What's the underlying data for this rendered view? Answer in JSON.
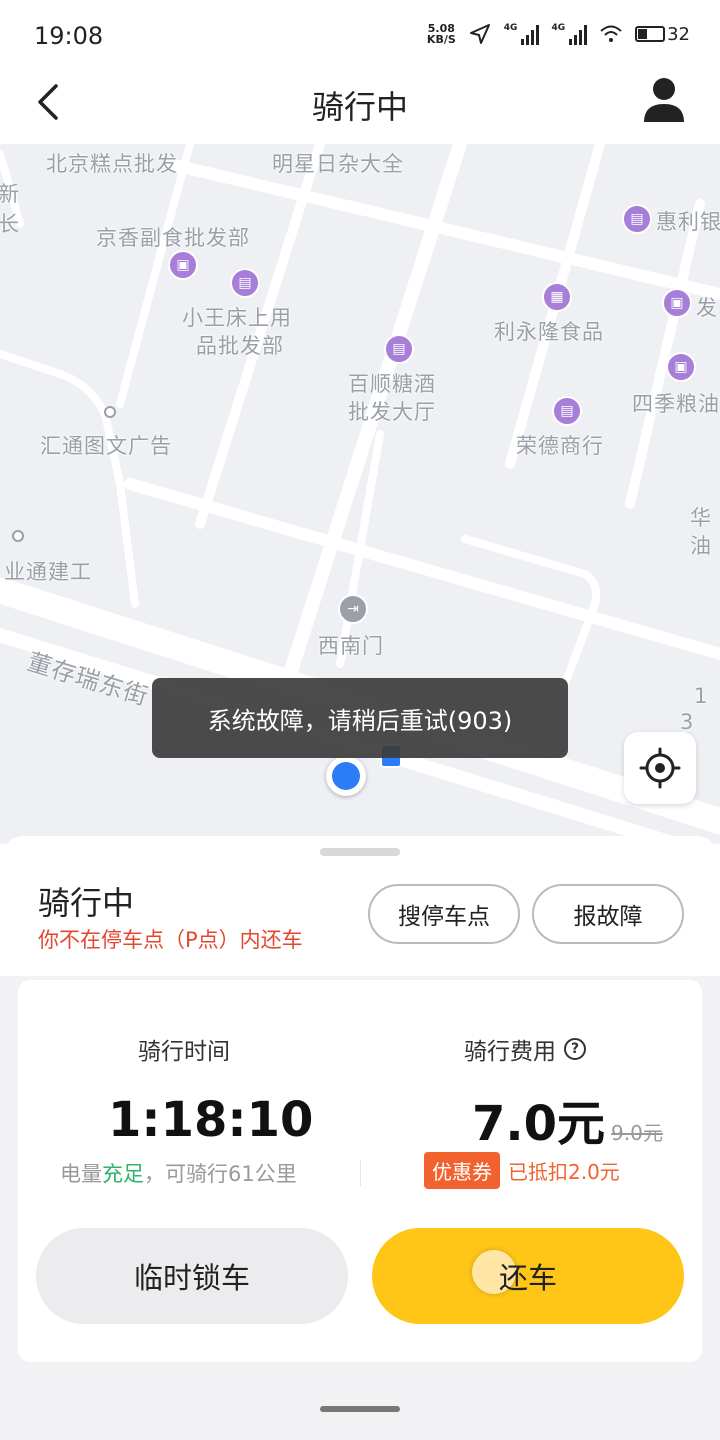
{
  "status_bar": {
    "time": "19:08",
    "net_speed": "5.08\nKB/S",
    "signal_label_1": "4G",
    "signal_label_2": "4G",
    "battery": "32"
  },
  "nav": {
    "title": "骑行中"
  },
  "map": {
    "labels": [
      "北京糕点批发",
      "明星日杂大全",
      "新",
      "长",
      "京香副食批发部",
      "惠利银",
      "小王床上用",
      "品批发部",
      "利永隆食品",
      "发",
      "百顺糖酒",
      "批发大厅",
      "四季粮油",
      "汇通图文广告",
      "荣德商行",
      "业通建工",
      "华",
      "油",
      "西南门",
      "董存瑞东街",
      "1",
      "3"
    ],
    "toast": "系统故障，请稍后重试(903)"
  },
  "sheet": {
    "status": "骑行中",
    "warning": "你不在停车点（P点）内还车",
    "find_parking": "搜停车点",
    "report_fault": "报故障",
    "ride_time_title": "骑行时间",
    "ride_time": "1:18:10",
    "battery_prefix": "电量",
    "battery_state": "充足",
    "battery_suffix": "，可骑行61公里",
    "fee_title": "骑行费用",
    "fee": "7.0元",
    "fee_original": "9.0元",
    "coupon_badge": "优惠券",
    "coupon_text": "已抵扣2.0元",
    "temp_lock": "临时锁车",
    "return_bike": "还车"
  },
  "colors": {
    "accent_yellow": "#ffc617",
    "warning_red": "#e6452e",
    "coupon_orange": "#f1622e",
    "battery_green": "#2db46a",
    "location_blue": "#2b7cf6",
    "poi_purple": "#a77fd8"
  }
}
